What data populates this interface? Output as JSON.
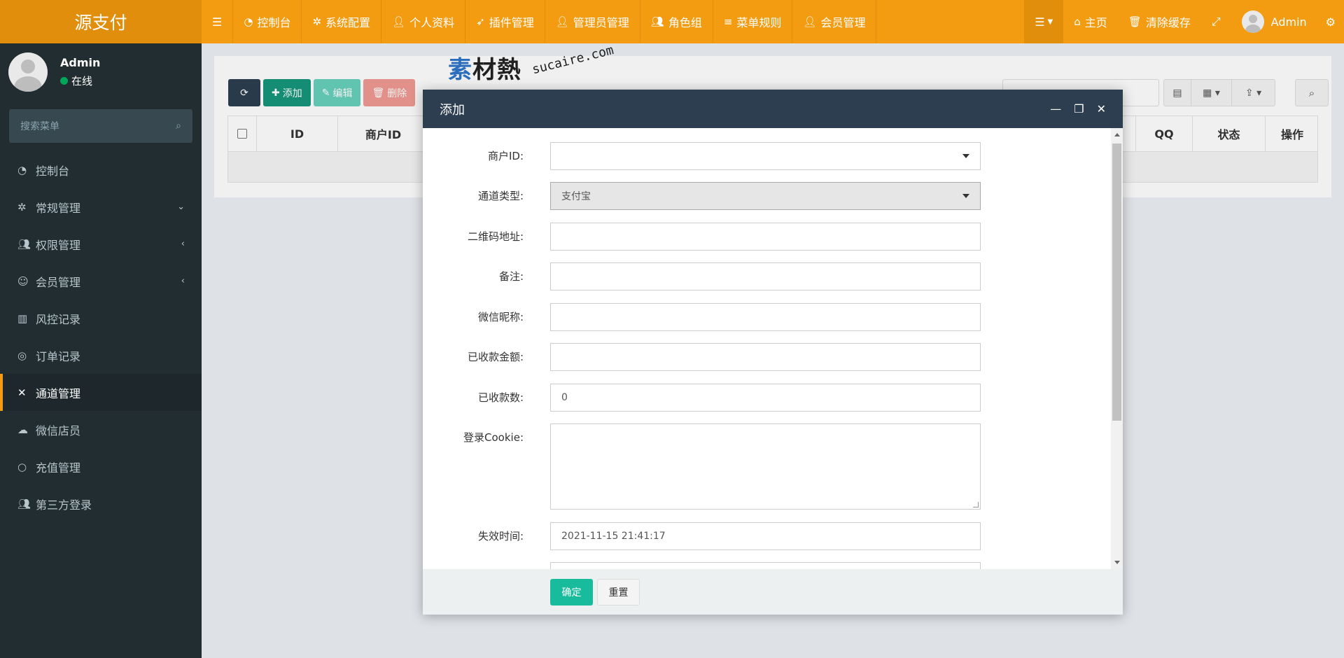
{
  "app": {
    "logo": "源支付"
  },
  "topnav": {
    "menu_icon": "hamburger-icon",
    "items": [
      {
        "icon": "dashboard-icon",
        "label": "控制台"
      },
      {
        "icon": "cog-icon",
        "label": "系统配置"
      },
      {
        "icon": "user-icon",
        "label": "个人资料"
      },
      {
        "icon": "rocket-icon",
        "label": "插件管理"
      },
      {
        "icon": "user-icon",
        "label": "管理员管理"
      },
      {
        "icon": "group-icon",
        "label": "角色组"
      },
      {
        "icon": "list-icon",
        "label": "菜单规则"
      },
      {
        "icon": "user-icon",
        "label": "会员管理"
      }
    ],
    "right": {
      "home": "主页",
      "clear_cache": "清除缓存",
      "username": "Admin"
    }
  },
  "sidebar": {
    "user": {
      "name": "Admin",
      "status": "在线",
      "status_color": "#00a65a"
    },
    "search_placeholder": "搜索菜单",
    "items": [
      {
        "icon": "dashboard-icon",
        "label": "控制台"
      },
      {
        "icon": "cogs-icon",
        "label": "常规管理",
        "arrow": "chevron-down-icon"
      },
      {
        "icon": "group-icon",
        "label": "权限管理",
        "arrow": "chevron-left-icon"
      },
      {
        "icon": "user-circle-icon",
        "label": "会员管理",
        "arrow": "chevron-left-icon"
      },
      {
        "icon": "map-icon",
        "label": "风控记录"
      },
      {
        "icon": "chrome-icon",
        "label": "订单记录"
      },
      {
        "icon": "xing-icon",
        "label": "通道管理",
        "active": true
      },
      {
        "icon": "wechat-icon",
        "label": "微信店员"
      },
      {
        "icon": "circle-icon",
        "label": "充值管理"
      },
      {
        "icon": "group-icon",
        "label": "第三方登录"
      }
    ]
  },
  "toolbar": {
    "add": "添加",
    "edit": "编辑",
    "delete": "删除"
  },
  "table": {
    "columns": [
      "ID",
      "商户ID",
      "QQ",
      "状态",
      "操作"
    ]
  },
  "modal": {
    "title": "添加",
    "fields": {
      "merchant_id_label": "商户ID:",
      "channel_type_label": "通道类型:",
      "channel_type_value": "支付宝",
      "qrcode_label": "二维码地址:",
      "remark_label": "备注:",
      "wechat_nick_label": "微信昵称:",
      "received_amount_label": "已收款金额:",
      "received_count_label": "已收款数:",
      "received_count_value": "0",
      "cookie_label": "登录Cookie:",
      "expire_label": "失效时间:",
      "expire_value": "2021-11-15 21:41:17"
    },
    "footer": {
      "ok": "确定",
      "reset": "重置"
    }
  },
  "watermark": {
    "big": "素材熱",
    "small": "sucaire.com"
  },
  "colors": {
    "header": "#f39c12",
    "logo_bg": "#e08e0b",
    "sidebar": "#222d32",
    "modal_head": "#2c3e50",
    "primary": "#18bc9c"
  }
}
